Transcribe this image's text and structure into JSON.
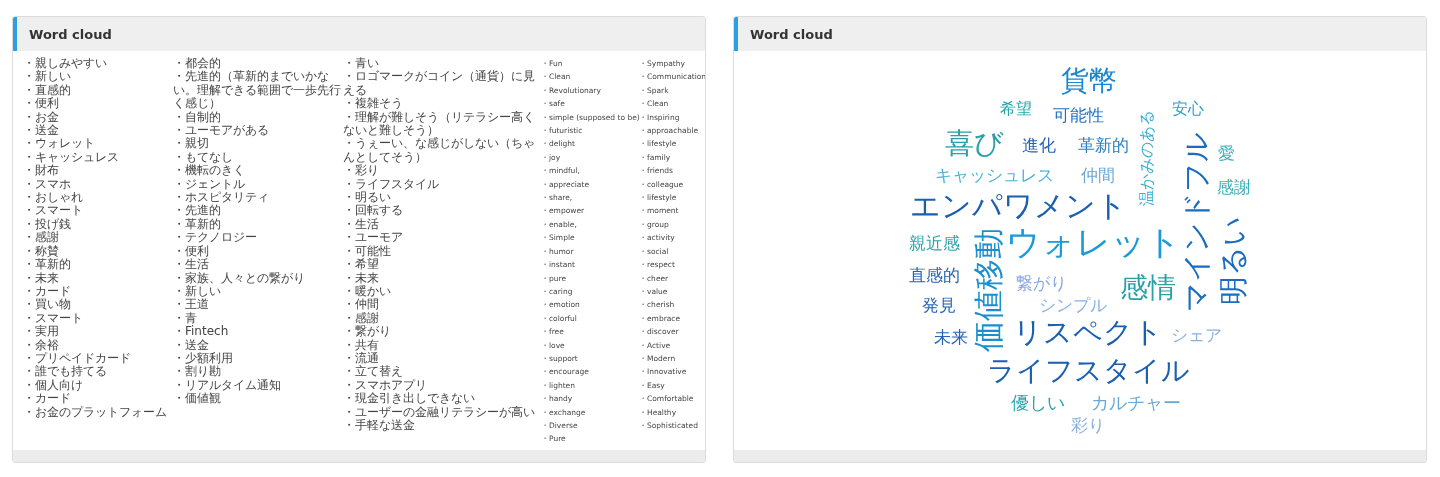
{
  "panels": [
    {
      "title": "Word cloud",
      "kind": "list",
      "columns": [
        [
          "・親しみやすい",
          "・新しい",
          "・直感的",
          "・便利",
          "・お金",
          "・送金",
          "・ウォレット",
          "・キャッシュレス",
          "・財布",
          "・スマホ",
          "・おしゃれ",
          "・スマート",
          "・投げ銭",
          "・感謝",
          "・称賛",
          "・革新的",
          "・未来",
          "・カード",
          "・買い物",
          "・スマート",
          "・実用",
          "・余裕",
          "・プリペイドカード",
          "・誰でも持てる",
          "・個人向け",
          "・カード",
          "・お金のプラットフォーム"
        ],
        [
          "・都会的",
          "・先進的（革新的までいかない。理解できる範囲で一歩先行く感じ）",
          "・自制的",
          "・ユーモアがある",
          "・親切",
          "・もてなし",
          "・機転のきく",
          "・ジェントル",
          "・ホスピタリティ",
          "・先進的",
          "・革新的",
          "・テクノロジー",
          "・便利",
          "・生活",
          "・家族、人々との繋がり",
          "・新しい",
          "・王道",
          "・青",
          "・Fintech",
          "・送金",
          "・少額利用",
          "・割り勘",
          "・リアルタイム通知",
          "・価値観"
        ],
        [
          "・青い",
          "・ロゴマークがコイン（通貨）に見える",
          "・複雑そう",
          "・理解が難しそう（リテラシー高くないと難しそう）",
          "・うぇーい、な感じがしない（ちゃんとしてそう）",
          "・彩り",
          "・ライフスタイル",
          "・明るい",
          "・回転する",
          "・生活",
          "・ユーモア",
          "・可能性",
          "・希望",
          "・未来",
          "・暖かい",
          "・仲間",
          "・感謝",
          "・繋がり",
          "・共有",
          "・流通",
          "・立て替え",
          "・スマホアプリ",
          "・現金引き出しできない",
          "・ユーザーの金融リテラシーが高い",
          "・手軽な送金"
        ],
        [
          "・Fun",
          "・Clean",
          "・Revolutionary",
          "・safe",
          "・simple (supposed to be)",
          "・futuristic",
          "・delight",
          "・joy",
          "・mindful,",
          "・appreciate",
          "・share,",
          "・empower",
          "・enable,",
          "・Simple",
          "・humor",
          "・instant",
          "・pure",
          "・caring",
          "・emotion",
          "・colorful",
          "・free",
          "・love",
          "・support",
          "・encourage",
          "・lighten",
          "・handy",
          "・exchange",
          "・Diverse",
          "・Pure"
        ],
        [
          "・Sympathy",
          "・Communication",
          "・Spark",
          "・Clean",
          "・Inspiring",
          "・approachable",
          "・lifestyle",
          "・family",
          "・friends",
          "・colleague",
          "・lifestyle",
          "・moment",
          "・group",
          "・activity",
          "・social",
          "・respect",
          "・cheer",
          "・value",
          "・cherish",
          "・embrace",
          "・discover",
          "・Active",
          "・Modern",
          "・Innovative",
          "・Easy",
          "・Comfortable",
          "・Healthy",
          "・Sophisticated"
        ]
      ]
    },
    {
      "title": "Word cloud",
      "kind": "cloud",
      "words": [
        {
          "text": "貨幣",
          "color": "#1a86d0",
          "vertical": false
        },
        {
          "text": "希望",
          "color": "#2aa3a8",
          "vertical": false
        },
        {
          "text": "可能性",
          "color": "#2471c4",
          "vertical": false
        },
        {
          "text": "温かみのある",
          "color": "#3aaed0",
          "vertical": true
        },
        {
          "text": "安心",
          "color": "#2aa3c8",
          "vertical": false
        },
        {
          "text": "喜び",
          "color": "#2aa0a8",
          "vertical": false
        },
        {
          "text": "進化",
          "color": "#2463b8",
          "vertical": false
        },
        {
          "text": "革新的",
          "color": "#2a7fc0",
          "vertical": false
        },
        {
          "text": "マインドフル",
          "color": "#1a6cc0",
          "vertical": true
        },
        {
          "text": "愛",
          "color": "#3ab0b8",
          "vertical": false
        },
        {
          "text": "キャッシュレス",
          "color": "#4ab4d8",
          "vertical": false
        },
        {
          "text": "仲間",
          "color": "#6aa8d8",
          "vertical": false
        },
        {
          "text": "感謝",
          "color": "#3ab0b8",
          "vertical": false
        },
        {
          "text": "エンパワメント",
          "color": "#1a5fb0",
          "vertical": false
        },
        {
          "text": "親近感",
          "color": "#2aa3a8",
          "vertical": false
        },
        {
          "text": "価値移動",
          "color": "#1a8fd0",
          "vertical": true
        },
        {
          "text": "ウォレット",
          "color": "#1a9ad8",
          "vertical": false
        },
        {
          "text": "明るい",
          "color": "#1a6cc0",
          "vertical": true
        },
        {
          "text": "直感的",
          "color": "#2463b8",
          "vertical": false
        },
        {
          "text": "繋がり",
          "color": "#8aa8e0",
          "vertical": false
        },
        {
          "text": "感情",
          "color": "#2aa0a8",
          "vertical": false
        },
        {
          "text": "発見",
          "color": "#2463b8",
          "vertical": false
        },
        {
          "text": "シンプル",
          "color": "#8ab0e0",
          "vertical": false
        },
        {
          "text": "未来",
          "color": "#2463b8",
          "vertical": false
        },
        {
          "text": "リスペクト",
          "color": "#1a5fb0",
          "vertical": false
        },
        {
          "text": "シェア",
          "color": "#8ab0e0",
          "vertical": false
        },
        {
          "text": "ライフスタイル",
          "color": "#1a5fb0",
          "vertical": false
        },
        {
          "text": "優しい",
          "color": "#2aa3a8",
          "vertical": false
        },
        {
          "text": "カルチャー",
          "color": "#6aa8d8",
          "vertical": false
        },
        {
          "text": "彩り",
          "color": "#8ab0e0",
          "vertical": false
        }
      ]
    }
  ]
}
